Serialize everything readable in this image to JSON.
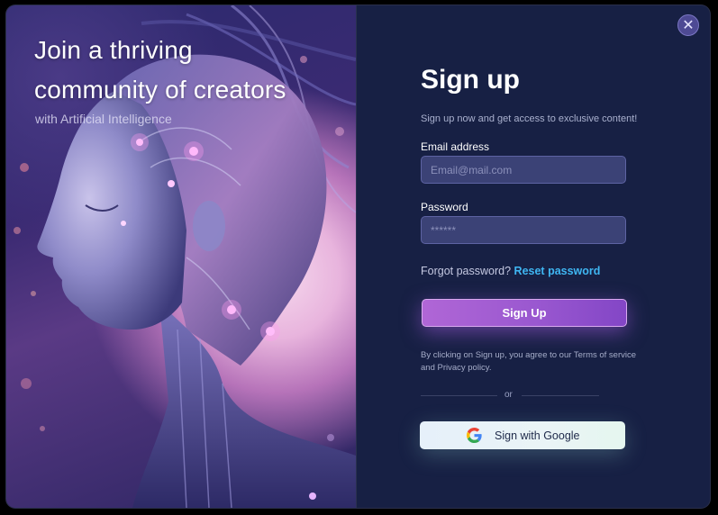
{
  "hero": {
    "title_line1": "Join a thriving",
    "title_line2": "community of creators",
    "subtitle": "with Artificial Intelligence"
  },
  "dialog": {
    "close_icon": "close-icon",
    "title": "Sign up",
    "subtitle": "Sign up now and get access to exclusive content!"
  },
  "form": {
    "email_label": "Email address",
    "email_placeholder": "Email@mail.com",
    "email_value": "",
    "password_label": "Password",
    "password_placeholder": "******",
    "password_value": "",
    "forgot_text": "Forgot password?",
    "reset_link": "Reset password",
    "signup_button": "Sign Up",
    "terms": "By clicking on Sign up, you agree to our Terms of service and Privacy policy.",
    "or_text": "or",
    "google_button": "Sign with Google",
    "google_icon": "google-icon"
  },
  "colors": {
    "background": "#172044",
    "accent_purple": "#9a58d0",
    "link_blue": "#3fb6f2",
    "input_bg": "#3b4276"
  }
}
